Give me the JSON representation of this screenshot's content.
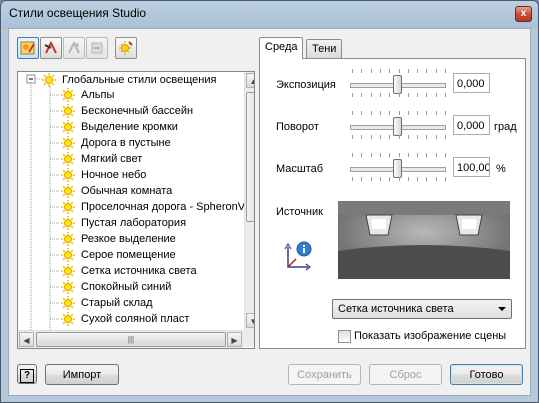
{
  "window": {
    "title": "Стили освещения Studio",
    "close_glyph": "x"
  },
  "toolbar": {
    "buttons": [
      "lighting-style-icon",
      "new-style-icon",
      "copy-style-icon",
      "purge-icon",
      "activate-style-icon"
    ]
  },
  "tree": {
    "root": "Глобальные стили освещения",
    "items": [
      "Альпы",
      "Бесконечный бассейн",
      "Выделение кромки",
      "Дорога в пустыне",
      "Мягкий свет",
      "Ночное небо",
      "Обычная комната",
      "Проселочная дорога - SpheronVR",
      "Пустая лаборатория",
      "Резкое выделение",
      "Серое помещение",
      "Сетка источника света",
      "Спокойный синий",
      "Старый склад",
      "Сухой соляной пласт"
    ],
    "hscroll_grip": "|||"
  },
  "tabs": [
    "Среда",
    "Тени"
  ],
  "panel": {
    "exposure": {
      "label": "Экспозиция",
      "value": "0,000",
      "unit": "",
      "level": 0.5
    },
    "rotation": {
      "label": "Поворот",
      "value": "0,000",
      "unit": "град",
      "level": 0.5
    },
    "scale": {
      "label": "Масштаб",
      "value": "100,00",
      "unit": "%",
      "level": 0.5
    },
    "source_label": "Источник",
    "source_value": "Сетка источника света",
    "show_scene_label": "Показать изображение сцены",
    "show_scene_checked": false
  },
  "buttons": {
    "help": "?",
    "import": "Импорт",
    "save": "Сохранить",
    "reset": "Сброс",
    "done": "Готово"
  },
  "colors": {
    "accent": "#3c7fb1",
    "titlebar": "#a9c0d6",
    "close": "#c8503a"
  }
}
